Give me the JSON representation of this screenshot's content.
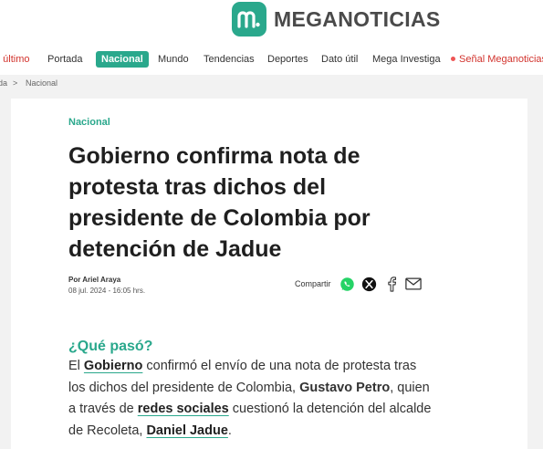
{
  "header": {
    "brand": "MEGANOTICIAS",
    "logo_icon": "m-logo-icon",
    "brand_color": "#2aa88c"
  },
  "nav": {
    "items": [
      {
        "label": "o último"
      },
      {
        "label": "Portada"
      },
      {
        "label": "Nacional"
      },
      {
        "label": "Mundo"
      },
      {
        "label": "Tendencias"
      },
      {
        "label": "Deportes"
      },
      {
        "label": "Dato útil"
      },
      {
        "label": "Mega Investiga"
      },
      {
        "label": "Señal Meganoticias"
      }
    ]
  },
  "breadcrumb": {
    "home": "da",
    "sep": ">",
    "current": "Nacional"
  },
  "article": {
    "section": "Nacional",
    "headline": "Gobierno confirma nota de protesta tras dichos del presidente de Colombia por detención de Jadue",
    "byline": "Por Ariel Araya",
    "date": "08 jul. 2024 - 16:05 hrs.",
    "share_label": "Compartir",
    "share_icons": [
      "whatsapp-icon",
      "x-icon",
      "facebook-icon",
      "email-icon"
    ],
    "subhead": "¿Qué pasó?",
    "body": {
      "t1": "El ",
      "l1": "Gobierno",
      "t2": " confirmó el envío de una nota de protesta tras los dichos del presidente de Colombia, ",
      "b1": "Gustavo Petro",
      "t3": ", quien a través de ",
      "l2": "redes sociales",
      "t4": " cuestionó la detención del alcalde de Recoleta, ",
      "l3": "Daniel Jadue",
      "t5": "."
    }
  }
}
